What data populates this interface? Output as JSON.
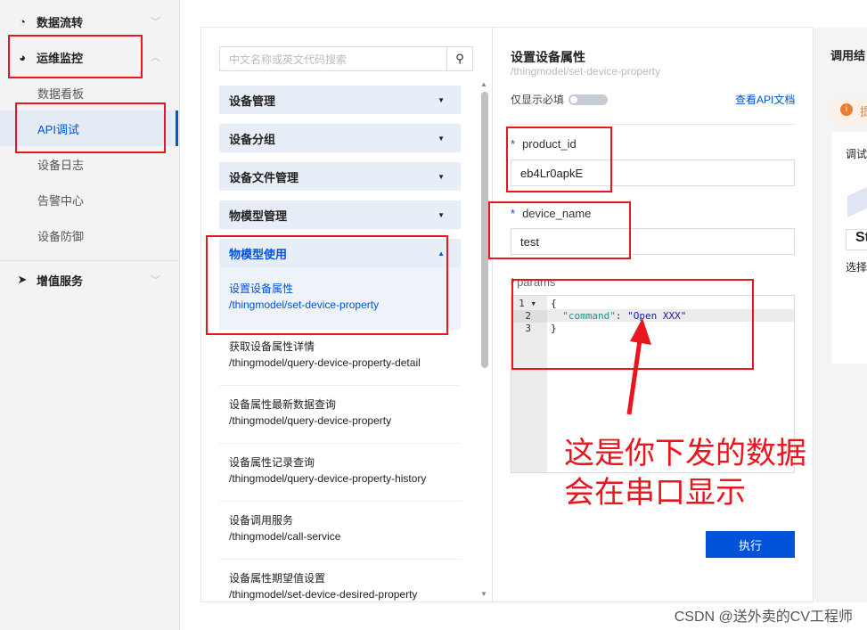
{
  "sidebar": {
    "groups": [
      {
        "label": "数据流转",
        "icon": "data-flow-icon"
      },
      {
        "label": "运维监控",
        "icon": "pie-chart-icon"
      },
      {
        "label": "增值服务",
        "icon": "send-icon"
      }
    ],
    "items": [
      "数据看板",
      "API调试",
      "设备日志",
      "告警中心",
      "设备防御"
    ],
    "active": "API调试"
  },
  "api_list": {
    "search_placeholder": "中文名称或英文代码搜索",
    "categories": [
      "设备管理",
      "设备分组",
      "设备文件管理",
      "物模型管理",
      "物模型使用"
    ],
    "apis": [
      {
        "name": "设置设备属性",
        "path": "/thingmodel/set-device-property"
      },
      {
        "name": "获取设备属性详情",
        "path": "/thingmodel/query-device-property-detail"
      },
      {
        "name": "设备属性最新数据查询",
        "path": "/thingmodel/query-device-property"
      },
      {
        "name": "设备属性记录查询",
        "path": "/thingmodel/query-device-property-history"
      },
      {
        "name": "设备调用服务",
        "path": "/thingmodel/call-service"
      },
      {
        "name": "设备属性期望值设置",
        "path": "/thingmodel/set-device-desired-property"
      }
    ]
  },
  "form": {
    "title": "设置设备属性",
    "path": "/thingmodel/set-device-property",
    "required_only_label": "仅显示必填",
    "required_only": false,
    "doc_link": "查看API文档",
    "fields": [
      {
        "label": "product_id",
        "value": "eb4Lr0apkE"
      },
      {
        "label": "device_name",
        "value": "test"
      }
    ],
    "params_label": "params",
    "required_mark": "*",
    "code_lines": [
      "{",
      "  \"command\": \"Open XXX\"",
      "}"
    ],
    "execute_label": "执行"
  },
  "result": {
    "title": "调用结",
    "tip": "提",
    "card_label": "调试",
    "badge": "St",
    "hint": "选择"
  },
  "annotation": {
    "line1": "这是你下发的数据",
    "line2": "会在串口显示",
    "color": "#e8161e"
  },
  "watermark": "CSDN @送外卖的CV工程师",
  "colors": {
    "accent": "#0052d9"
  }
}
